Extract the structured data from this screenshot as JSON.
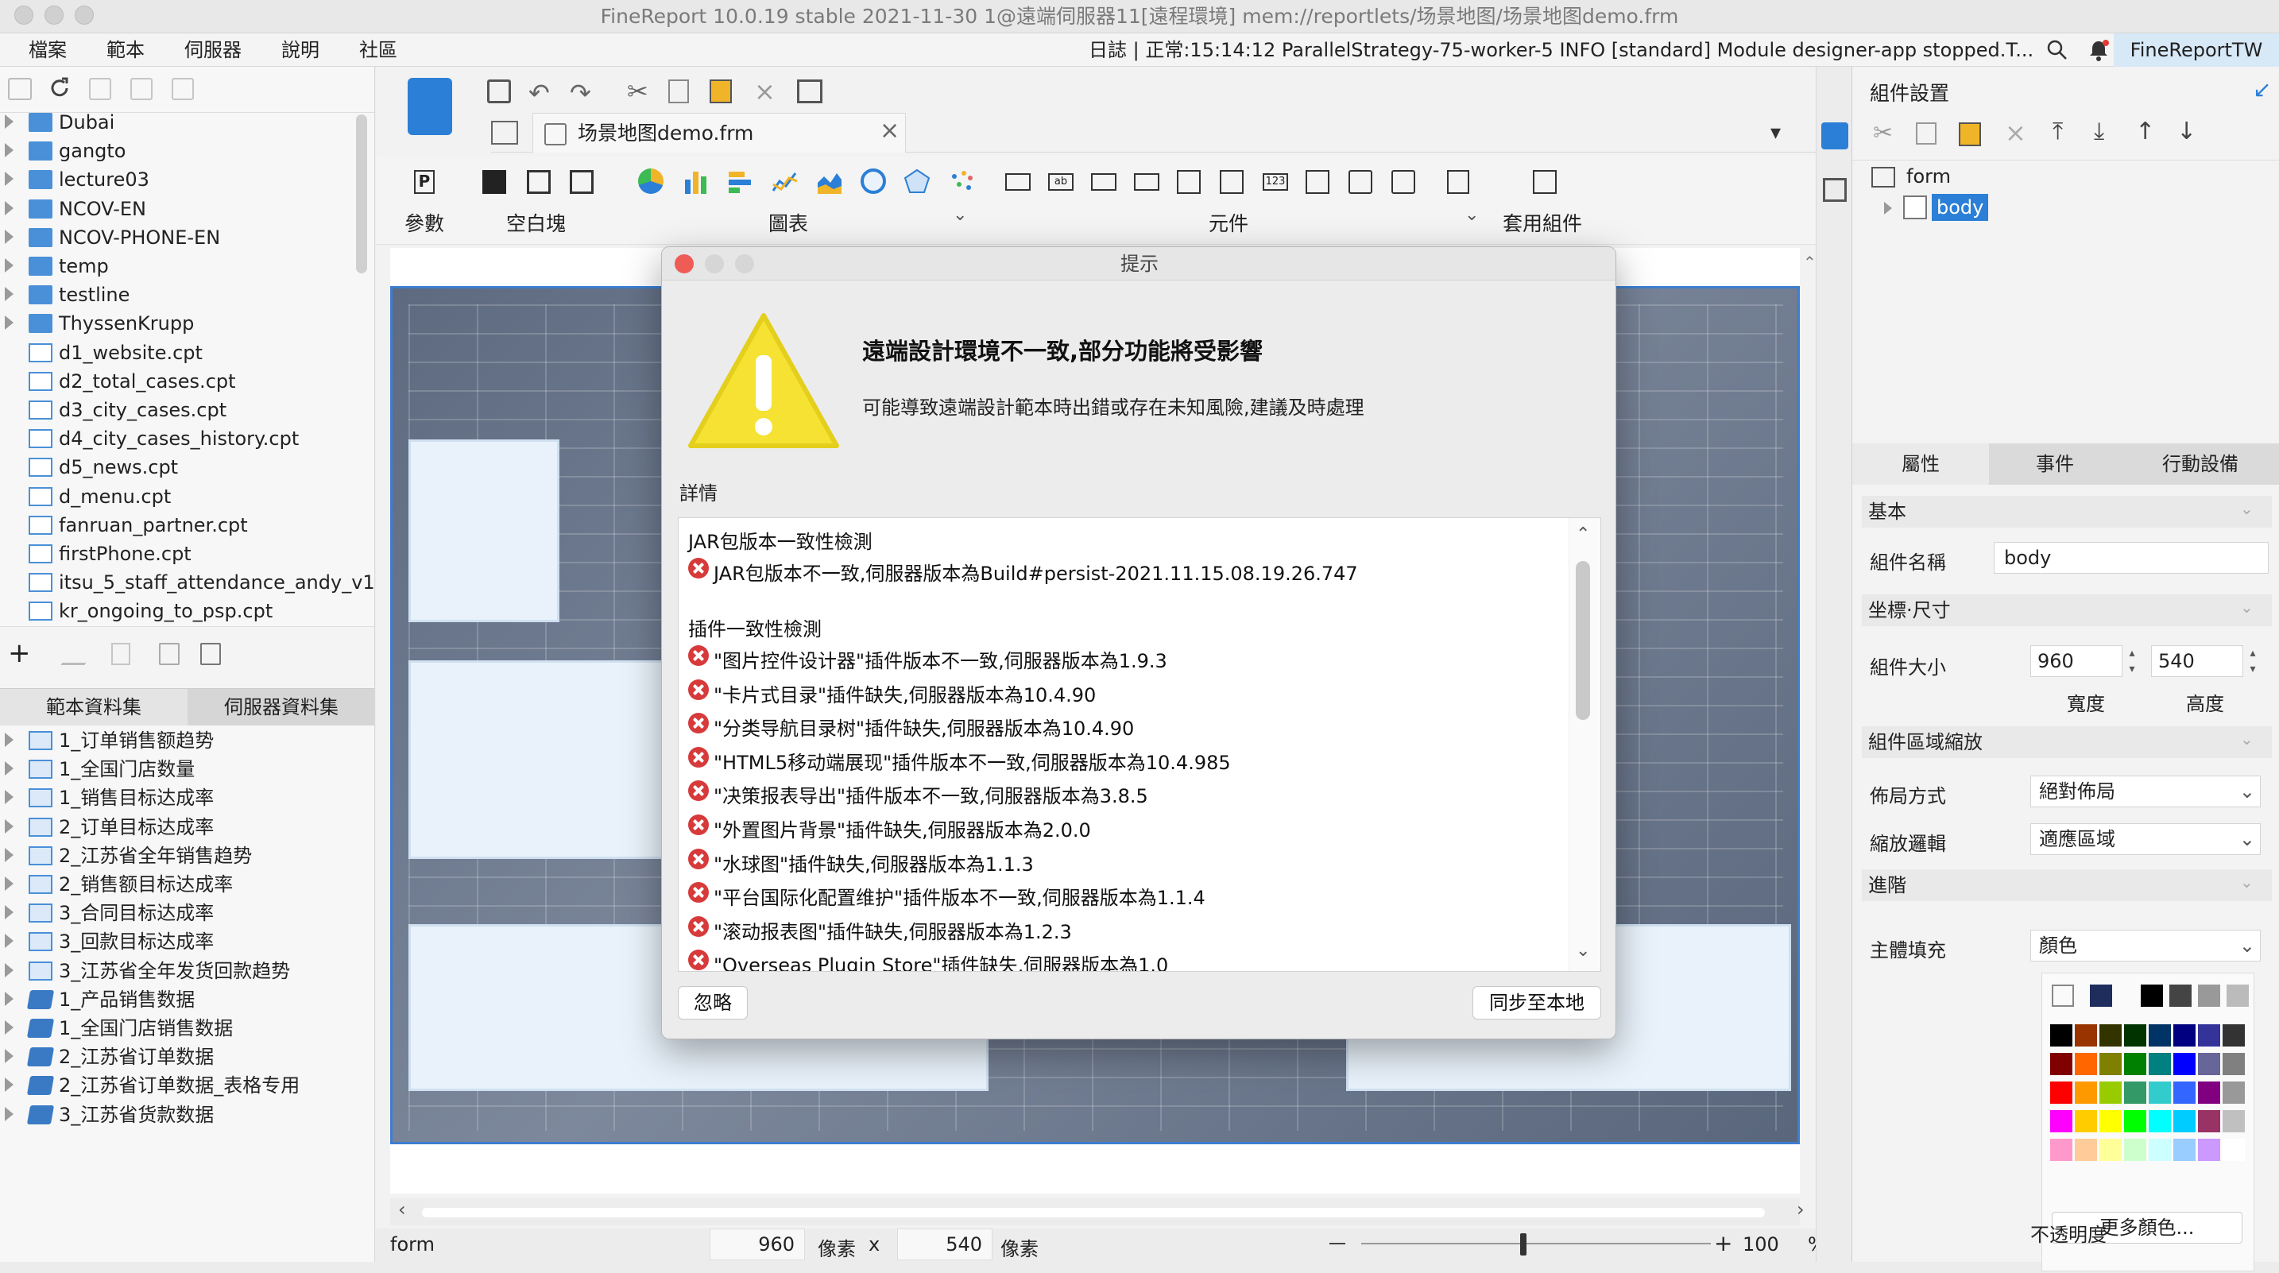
{
  "window": {
    "title": "FineReport 10.0.19 stable 2021-11-30 1@遠端伺服器11[遠程環境]    mem://reportlets/场景地图/场景地图demo.frm"
  },
  "menubar": {
    "items": [
      "檔案",
      "範本",
      "伺服器",
      "說明",
      "社區"
    ],
    "log": "日誌 | 正常:15:14:12 ParallelStrategy-75-worker-5 INFO [standard] Module designer-app stopped.T...",
    "user": "FineReportTW"
  },
  "left_panel": {
    "tree": [
      {
        "label": "Dubai",
        "type": "folder"
      },
      {
        "label": "gangto",
        "type": "folder"
      },
      {
        "label": "lecture03",
        "type": "folder"
      },
      {
        "label": "NCOV-EN",
        "type": "folder"
      },
      {
        "label": "NCOV-PHONE-EN",
        "type": "folder"
      },
      {
        "label": "temp",
        "type": "folder"
      },
      {
        "label": "testline",
        "type": "folder"
      },
      {
        "label": "ThyssenKrupp",
        "type": "folder"
      },
      {
        "label": "d1_website.cpt",
        "type": "file"
      },
      {
        "label": "d2_total_cases.cpt",
        "type": "file"
      },
      {
        "label": "d3_city_cases.cpt",
        "type": "file"
      },
      {
        "label": "d4_city_cases_history.cpt",
        "type": "file"
      },
      {
        "label": "d5_news.cpt",
        "type": "file"
      },
      {
        "label": "d_menu.cpt",
        "type": "file"
      },
      {
        "label": "fanruan_partner.cpt",
        "type": "file"
      },
      {
        "label": "firstPhone.cpt",
        "type": "file"
      },
      {
        "label": "itsu_5_staff_attendance_andy_v1",
        "type": "file"
      },
      {
        "label": "kr_ongoing_to_psp.cpt",
        "type": "file"
      }
    ],
    "tabs": [
      "範本資料集",
      "伺服器資料集"
    ],
    "datasets": [
      {
        "label": "1_订单销售额趋势",
        "type": "table"
      },
      {
        "label": "1_全国门店数量",
        "type": "table"
      },
      {
        "label": "1_销售目标达成率",
        "type": "table"
      },
      {
        "label": "2_订单目标达成率",
        "type": "table"
      },
      {
        "label": "2_江苏省全年销售趋势",
        "type": "table"
      },
      {
        "label": "2_销售额目标达成率",
        "type": "table"
      },
      {
        "label": "3_合同目标达成率",
        "type": "table"
      },
      {
        "label": "3_回款目标达成率",
        "type": "table"
      },
      {
        "label": "3_江苏省全年发货回款趋势",
        "type": "table"
      },
      {
        "label": "1_产品销售数据",
        "type": "db"
      },
      {
        "label": "1_全国门店销售数据",
        "type": "db"
      },
      {
        "label": "2_江苏省订单数据",
        "type": "db"
      },
      {
        "label": "2_江苏省订单数据_表格专用",
        "type": "db"
      },
      {
        "label": "3_江苏省货款数据",
        "type": "db"
      }
    ]
  },
  "editor": {
    "doc_tab": "场景地图demo.frm",
    "groups": [
      "參數",
      "空白塊",
      "圖表",
      "元件",
      "套用組件"
    ],
    "status": {
      "mode": "form",
      "width": "960",
      "width_unit": "像素",
      "times": "x",
      "height": "540",
      "height_unit": "像素",
      "zoom": "100",
      "zoom_unit": "%"
    }
  },
  "right_panel": {
    "title": "組件設置",
    "tree": {
      "root": "form",
      "child": "body"
    },
    "tabs": [
      "屬性",
      "事件",
      "行動設備"
    ],
    "sections": {
      "basic": "基本",
      "position": "坐標·尺寸",
      "scale": "組件區域縮放",
      "advanced": "進階"
    },
    "name_label": "組件名稱",
    "name_value": "body",
    "size_label": "組件大小",
    "width": "960",
    "height": "540",
    "width_label": "寬度",
    "height_label": "高度",
    "layout_label": "佈局方式",
    "layout_value": "絕對佈局",
    "scale_label": "縮放邏輯",
    "scale_value": "適應區域",
    "fill_label": "主體填充",
    "fill_value": "顏色",
    "more_colors": "更多顏色...",
    "opacity_label": "不透明度",
    "palette": [
      "#000000",
      "#993300",
      "#333300",
      "#003300",
      "#003366",
      "#000080",
      "#333399",
      "#333333",
      "#800000",
      "#ff6600",
      "#808000",
      "#008000",
      "#008080",
      "#0000ff",
      "#666699",
      "#808080",
      "#ff0000",
      "#ff9900",
      "#99cc00",
      "#339966",
      "#33cccc",
      "#3366ff",
      "#800080",
      "#999999",
      "#ff00ff",
      "#ffcc00",
      "#ffff00",
      "#00ff00",
      "#00ffff",
      "#00ccff",
      "#993366",
      "#c0c0c0",
      "#ff99cc",
      "#ffcc99",
      "#ffff99",
      "#ccffcc",
      "#ccffff",
      "#99ccff",
      "#cc99ff",
      "#ffffff"
    ],
    "recent": [
      "#1f2d5c",
      "#000000",
      "#444444",
      "#999999",
      "#bbbbbb"
    ]
  },
  "dialog": {
    "title": "提示",
    "heading": "遠端設計環境不一致,部分功能將受影響",
    "subtext": "可能導致遠端設計範本時出錯或存在未知風險,建議及時處理",
    "details_label": "詳情",
    "jar_header": "JAR包版本一致性檢測",
    "jar_error": "JAR包版本不一致,伺服器版本為Build#persist-2021.11.15.08.19.26.747",
    "plugin_header": "插件一致性檢測",
    "plugin_errors": [
      "\"图片控件设计器\"插件版本不一致,伺服器版本為1.9.3",
      "\"卡片式目录\"插件缺失,伺服器版本為10.4.90",
      "\"分类导航目录树\"插件缺失,伺服器版本為10.4.90",
      "\"HTML5移动端展现\"插件版本不一致,伺服器版本為10.4.985",
      "\"决策报表导出\"插件版本不一致,伺服器版本為3.8.5",
      "\"外置图片背景\"插件缺失,伺服器版本為2.0.0",
      "\"水球图\"插件缺失,伺服器版本為1.1.3",
      "\"平台国际化配置维护\"插件版本不一致,伺服器版本為1.1.4",
      "\"滚动报表图\"插件缺失,伺服器版本為1.2.3",
      "\"Overseas Plugin Store\"插件缺失,伺服器版本為1.0"
    ],
    "ignore_button": "忽略",
    "sync_button": "同步至本地"
  }
}
